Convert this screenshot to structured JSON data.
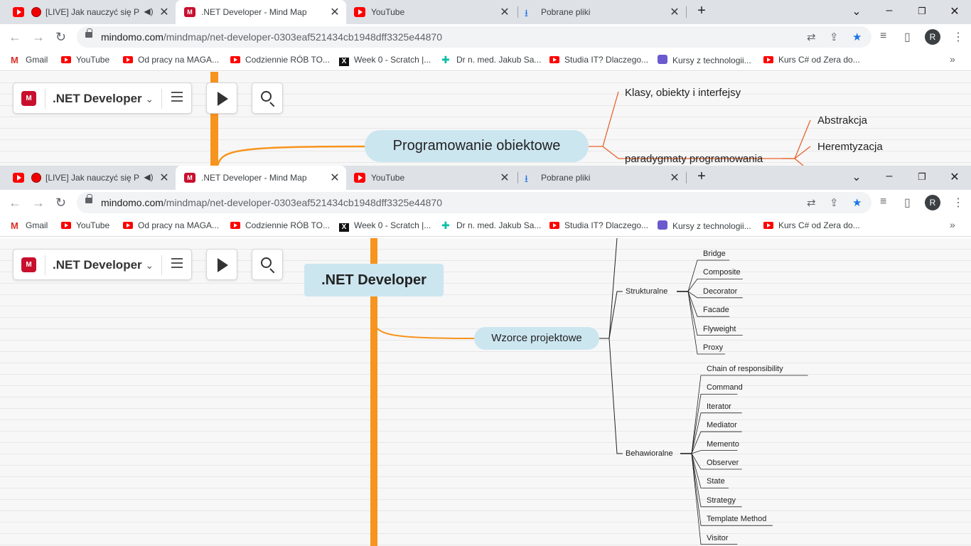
{
  "browser": {
    "tabs": [
      {
        "label": "[LIVE] Jak nauczyć się Pro",
        "recording": true,
        "audio": true
      },
      {
        "label": ".NET Developer - Mind Map",
        "active": true
      },
      {
        "label": "YouTube"
      },
      {
        "label": "Pobrane pliki"
      }
    ],
    "new_tab": "+",
    "url_domain": "mindomo.com",
    "url_path": "/mindmap/net-developer-0303eaf521434cb1948dff3325e44870",
    "profile_initial": "R",
    "bookmarks": [
      {
        "label": "Gmail",
        "icon": "gmail-icon"
      },
      {
        "label": "YouTube",
        "icon": "youtube-icon"
      },
      {
        "label": "Od pracy na MAGA...",
        "icon": "youtube-icon"
      },
      {
        "label": "Codziennie RÓB TO...",
        "icon": "youtube-icon"
      },
      {
        "label": "Week 0 - Scratch |...",
        "icon": "cs50-icon"
      },
      {
        "label": "Dr n. med. Jakub Sa...",
        "icon": "cross-icon"
      },
      {
        "label": "Studia IT? Dlaczego...",
        "icon": "youtube-icon"
      },
      {
        "label": "Kursy z technologii...",
        "icon": "layers-icon"
      },
      {
        "label": "Kurs C# od Zera do...",
        "icon": "youtube-icon"
      }
    ],
    "bookmarks_more": "»"
  },
  "mindmap": {
    "map_title": ".NET Developer",
    "central": ".NET Developer",
    "top_view": {
      "topic": "Programowanie obiektowe",
      "children": [
        "Klasy, obiekty i interfejsy",
        "paradygmaty programowania"
      ],
      "sub_children": [
        "Abstrakcja",
        "Heremtyzacja"
      ]
    },
    "bottom_view": {
      "topic": "Wzorce projektowe",
      "strukturalne": {
        "label": "Strukturalne",
        "items": [
          "Bridge",
          "Composite",
          "Decorator",
          "Facade",
          "Flyweight",
          "Proxy"
        ]
      },
      "behawioralne": {
        "label": "Behawioralne",
        "items": [
          "Chain of responsibility",
          "Command",
          "Iterator",
          "Mediator",
          "Memento",
          "Observer",
          "State",
          "Strategy",
          "Template Method",
          "Visitor"
        ]
      }
    }
  },
  "colors": {
    "branch_orange": "#f7941d",
    "connector_orange": "#e8622c",
    "topic_fill": "#cce6f0",
    "brand_red": "#c8102e"
  }
}
